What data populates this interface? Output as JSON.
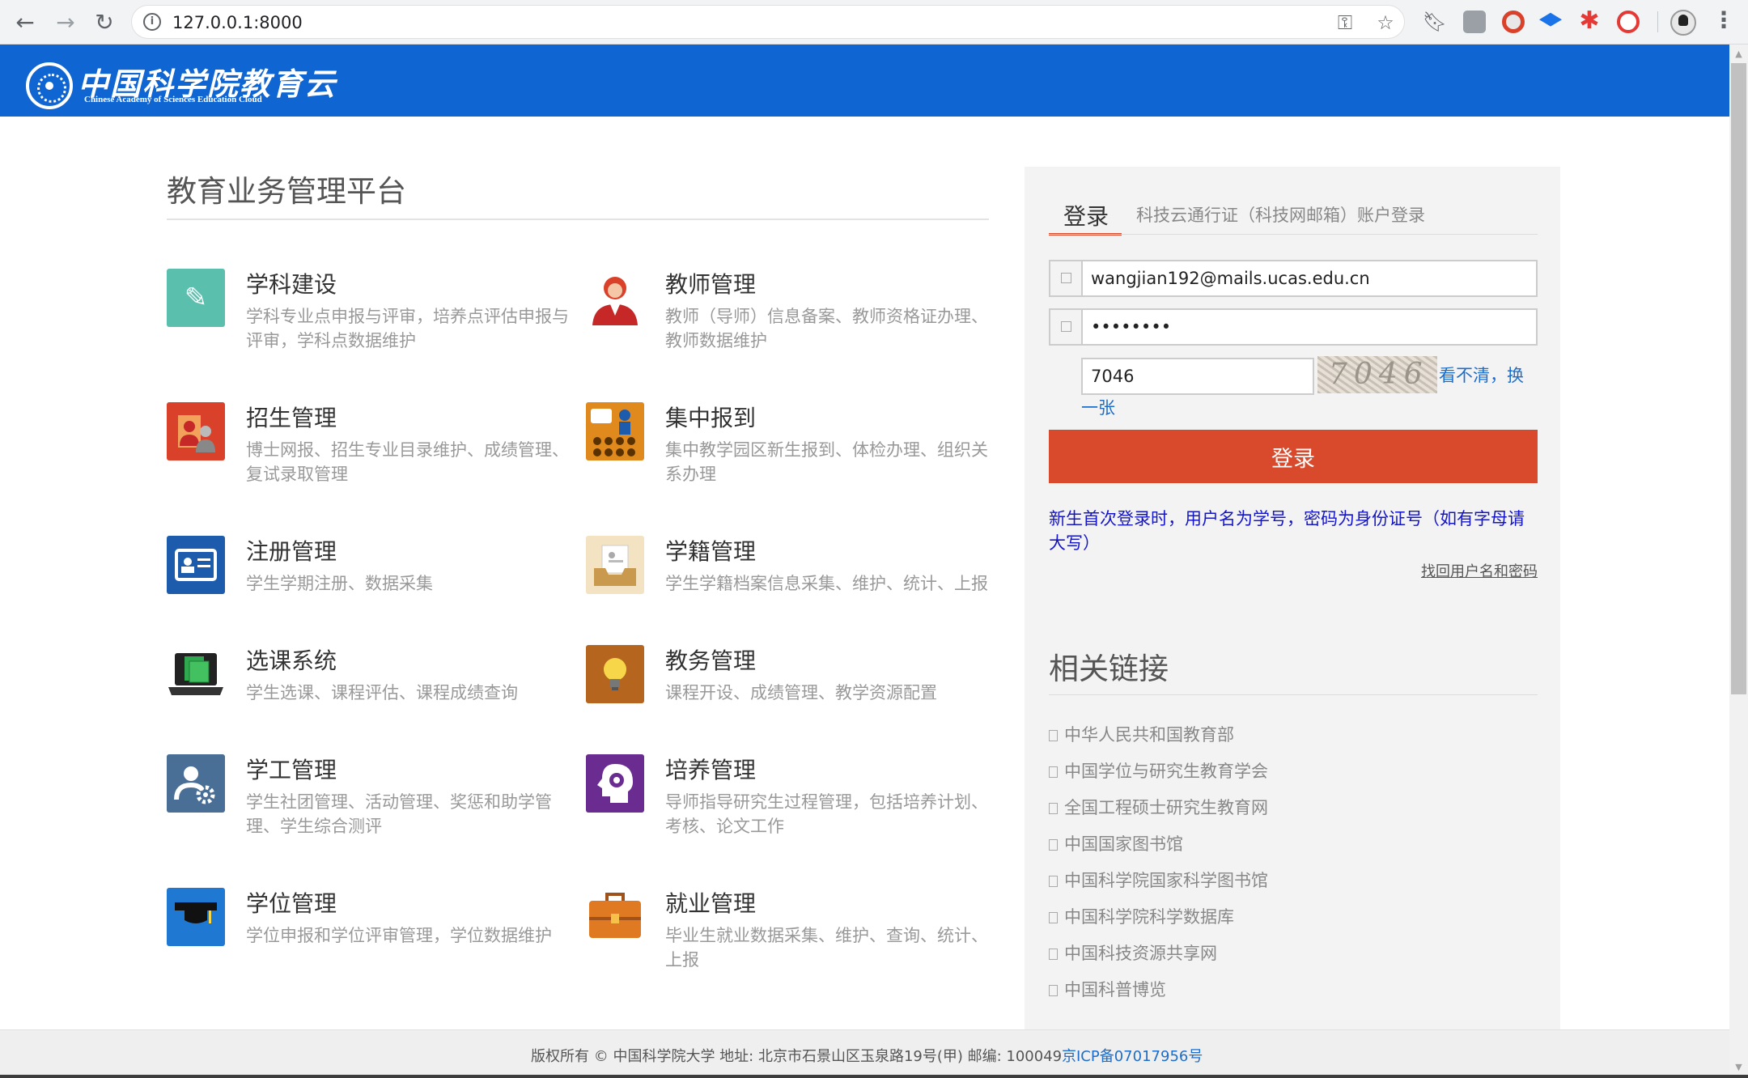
{
  "browser": {
    "url": "127.0.0.1:8000"
  },
  "site": {
    "logo_title": "中国科学院教育云",
    "logo_subtitle": "Chinese Academy of Sciences Education Cloud",
    "brand_color": "#0f65d2"
  },
  "main": {
    "title": "教育业务管理平台",
    "modules": [
      {
        "name": "学科建设",
        "desc": "学科专业点申报与评审，培养点评估申报与评审，学科点数据维护",
        "icon": "book-pen-icon",
        "color": "#5bbfae"
      },
      {
        "name": "教师管理",
        "desc": "教师（导师）信息备案、教师资格证办理、教师数据维护",
        "icon": "teacher-icon",
        "color": "#ffffff"
      },
      {
        "name": "招生管理",
        "desc": "博士网报、招生专业目录维护、成绩管理、复试录取管理",
        "icon": "enrollment-icon",
        "color": "#d9412b"
      },
      {
        "name": "集中报到",
        "desc": "集中教学园区新生报到、体检办理、组织关系办理",
        "icon": "conference-icon",
        "color": "#e08a1e"
      },
      {
        "name": "注册管理",
        "desc": "学生学期注册、数据采集",
        "icon": "id-card-icon",
        "color": "#1d5cac"
      },
      {
        "name": "学籍管理",
        "desc": "学生学籍档案信息采集、维护、统计、上报",
        "icon": "archive-icon",
        "color": "#e0c48a"
      },
      {
        "name": "选课系统",
        "desc": "学生选课、课程评估、课程成绩查询",
        "icon": "laptop-icon",
        "color": "#2fa84f"
      },
      {
        "name": "教务管理",
        "desc": "课程开设、成绩管理、教学资源配置",
        "icon": "lightbulb-icon",
        "color": "#b5651d"
      },
      {
        "name": "学工管理",
        "desc": "学生社团管理、活动管理、奖惩和助学管理、学生综合测评",
        "icon": "user-gear-icon",
        "color": "#4a6f96"
      },
      {
        "name": "培养管理",
        "desc": "导师指导研究生过程管理，包括培养计划、考核、论文工作",
        "icon": "head-gear-icon",
        "color": "#6a2c91"
      },
      {
        "name": "学位管理",
        "desc": "学位申报和学位评审管理，学位数据维护",
        "icon": "graduation-cap-icon",
        "color": "#1f78d1"
      },
      {
        "name": "就业管理",
        "desc": "毕业生就业数据采集、维护、查询、统计、上报",
        "icon": "briefcase-icon",
        "color": "#e07a22"
      }
    ]
  },
  "login": {
    "tab_active": "登录",
    "tab_other": "科技云通行证（科技网邮箱）账户登录",
    "username": "wangjian192@mails.ucas.edu.cn",
    "password_masked": "••••••••",
    "captcha_value": "7046",
    "captcha_image_text": "7046",
    "refresh_text_1": "看不清，换",
    "refresh_text_2": "一张",
    "submit_label": "登录",
    "notice": "新生首次登录时，用户名为学号，密码为身份证号（如有字母请大写）",
    "recover_link": "找回用户名和密码",
    "accent_color": "#d94a2c"
  },
  "links": {
    "title": "相关链接",
    "items": [
      "中华人民共和国教育部",
      "中国学位与研究生教育学会",
      "全国工程硕士研究生教育网",
      "中国国家图书馆",
      "中国科学院国家科学图书馆",
      "中国科学院科学数据库",
      "中国科技资源共享网",
      "中国科普博览"
    ]
  },
  "footer": {
    "text": "版权所有 © 中国科学院大学 地址: 北京市石景山区玉泉路19号(甲) 邮编: 100049",
    "icp_link": "京ICP备07017956号"
  }
}
